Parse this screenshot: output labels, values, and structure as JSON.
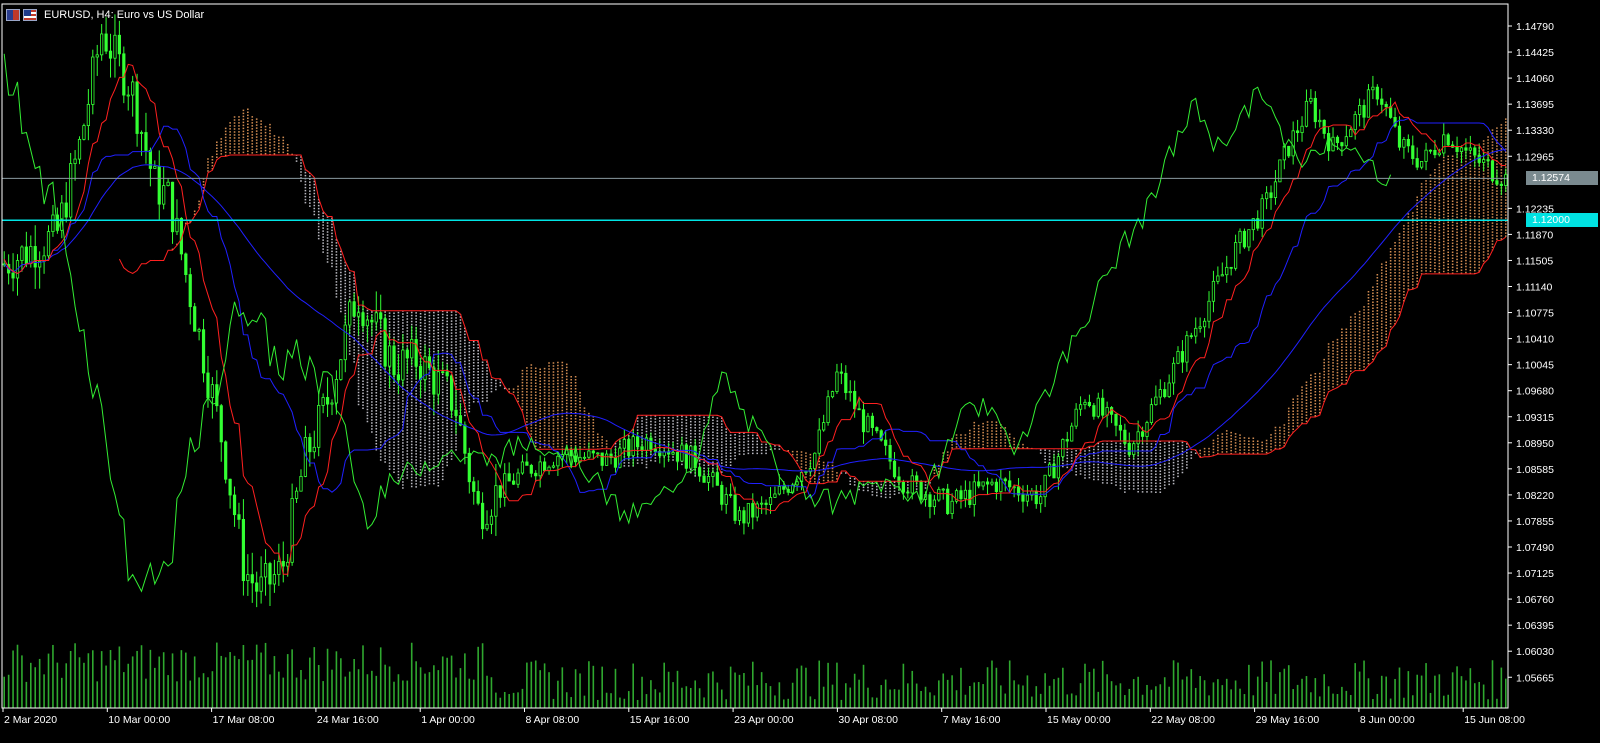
{
  "window": {
    "symbol_title": "EURUSD, H4:  Euro vs US Dollar",
    "symbol_icon": "currency-pair-icon",
    "flag_icon": "us-flag-icon"
  },
  "colors": {
    "background": "#000000",
    "axis": "#ffffff",
    "candle": "#33ff33",
    "tenkan": "#ff2020",
    "kijun": "#2020ff",
    "chikou": "#33ee33",
    "senkou_red": "#ff2020",
    "cloud_up": "#f4a460",
    "cloud_down": "#d8d8e0",
    "volume": "#2fa82f",
    "bid_line": "#8a9aa0",
    "level_line": "#00e5e5"
  },
  "price_axis": {
    "labels": [
      "1.14790",
      "1.14425",
      "1.14060",
      "1.13695",
      "1.13330",
      "1.12965",
      "1.12235",
      "1.11870",
      "1.11505",
      "1.11140",
      "1.10775",
      "1.10410",
      "1.10045",
      "1.09680",
      "1.09315",
      "1.08950",
      "1.08585",
      "1.08220",
      "1.07855",
      "1.07490",
      "1.07125",
      "1.06760",
      "1.06395",
      "1.06030",
      "1.05665"
    ]
  },
  "time_axis": {
    "labels": [
      "2 Mar 2020",
      "10 Mar 00:00",
      "17 Mar 08:00",
      "24 Mar 16:00",
      "1 Apr 00:00",
      "8 Apr 08:00",
      "15 Apr 16:00",
      "23 Apr 00:00",
      "30 Apr 08:00",
      "7 May 16:00",
      "15 May 00:00",
      "22 May 08:00",
      "29 May 16:00",
      "8 Jun 00:00",
      "15 Jun 08:00"
    ]
  },
  "price_lines": {
    "bid_label": "1.12574",
    "level_label": "1.12000"
  },
  "chart_data": {
    "type": "candlestick",
    "symbol": "EURUSD",
    "timeframe": "H4",
    "ylim": [
      1.053,
      1.1497
    ],
    "bid": 1.12574,
    "horizontal_level": 1.12,
    "price_path": [
      {
        "t": 0,
        "p": 1.114
      },
      {
        "t": 0.035,
        "p": 1.118
      },
      {
        "t": 0.05,
        "p": 1.13
      },
      {
        "t": 0.065,
        "p": 1.146
      },
      {
        "t": 0.085,
        "p": 1.138
      },
      {
        "t": 0.1,
        "p": 1.125
      },
      {
        "t": 0.11,
        "p": 1.123
      },
      {
        "t": 0.13,
        "p": 1.104
      },
      {
        "t": 0.145,
        "p": 1.09
      },
      {
        "t": 0.16,
        "p": 1.072
      },
      {
        "t": 0.17,
        "p": 1.069
      },
      {
        "t": 0.185,
        "p": 1.072
      },
      {
        "t": 0.2,
        "p": 1.087
      },
      {
        "t": 0.215,
        "p": 1.095
      },
      {
        "t": 0.235,
        "p": 1.11
      },
      {
        "t": 0.245,
        "p": 1.106
      },
      {
        "t": 0.26,
        "p": 1.1
      },
      {
        "t": 0.275,
        "p": 1.101
      },
      {
        "t": 0.3,
        "p": 1.095
      },
      {
        "t": 0.315,
        "p": 1.08
      },
      {
        "t": 0.33,
        "p": 1.083
      },
      {
        "t": 0.35,
        "p": 1.086
      },
      {
        "t": 0.37,
        "p": 1.088
      },
      {
        "t": 0.4,
        "p": 1.087
      },
      {
        "t": 0.43,
        "p": 1.09
      },
      {
        "t": 0.46,
        "p": 1.087
      },
      {
        "t": 0.49,
        "p": 1.079
      },
      {
        "t": 0.51,
        "p": 1.081
      },
      {
        "t": 0.54,
        "p": 1.088
      },
      {
        "t": 0.555,
        "p": 1.099
      },
      {
        "t": 0.57,
        "p": 1.093
      },
      {
        "t": 0.6,
        "p": 1.084
      },
      {
        "t": 0.63,
        "p": 1.081
      },
      {
        "t": 0.66,
        "p": 1.084
      },
      {
        "t": 0.69,
        "p": 1.082
      },
      {
        "t": 0.72,
        "p": 1.096
      },
      {
        "t": 0.75,
        "p": 1.089
      },
      {
        "t": 0.78,
        "p": 1.1
      },
      {
        "t": 0.8,
        "p": 1.108
      },
      {
        "t": 0.82,
        "p": 1.116
      },
      {
        "t": 0.84,
        "p": 1.122
      },
      {
        "t": 0.855,
        "p": 1.13
      },
      {
        "t": 0.87,
        "p": 1.136
      },
      {
        "t": 0.885,
        "p": 1.13
      },
      {
        "t": 0.9,
        "p": 1.134
      },
      {
        "t": 0.915,
        "p": 1.138
      },
      {
        "t": 0.93,
        "p": 1.13
      },
      {
        "t": 0.945,
        "p": 1.128
      },
      {
        "t": 0.96,
        "p": 1.132
      },
      {
        "t": 0.975,
        "p": 1.129
      },
      {
        "t": 1,
        "p": 1.1257
      }
    ],
    "indicators": [
      {
        "name": "Tenkan-sen",
        "color": "#ff2020"
      },
      {
        "name": "Kijun-sen",
        "color": "#2020ff"
      },
      {
        "name": "Senkou Span",
        "color": "#ff2020"
      },
      {
        "name": "Chikou Span",
        "color": "#33ee33"
      },
      {
        "name": "Kumo cloud",
        "colors": [
          "#f4a460",
          "#d8d8e0"
        ]
      },
      {
        "name": "Volumes",
        "color": "#2fa82f"
      }
    ]
  }
}
